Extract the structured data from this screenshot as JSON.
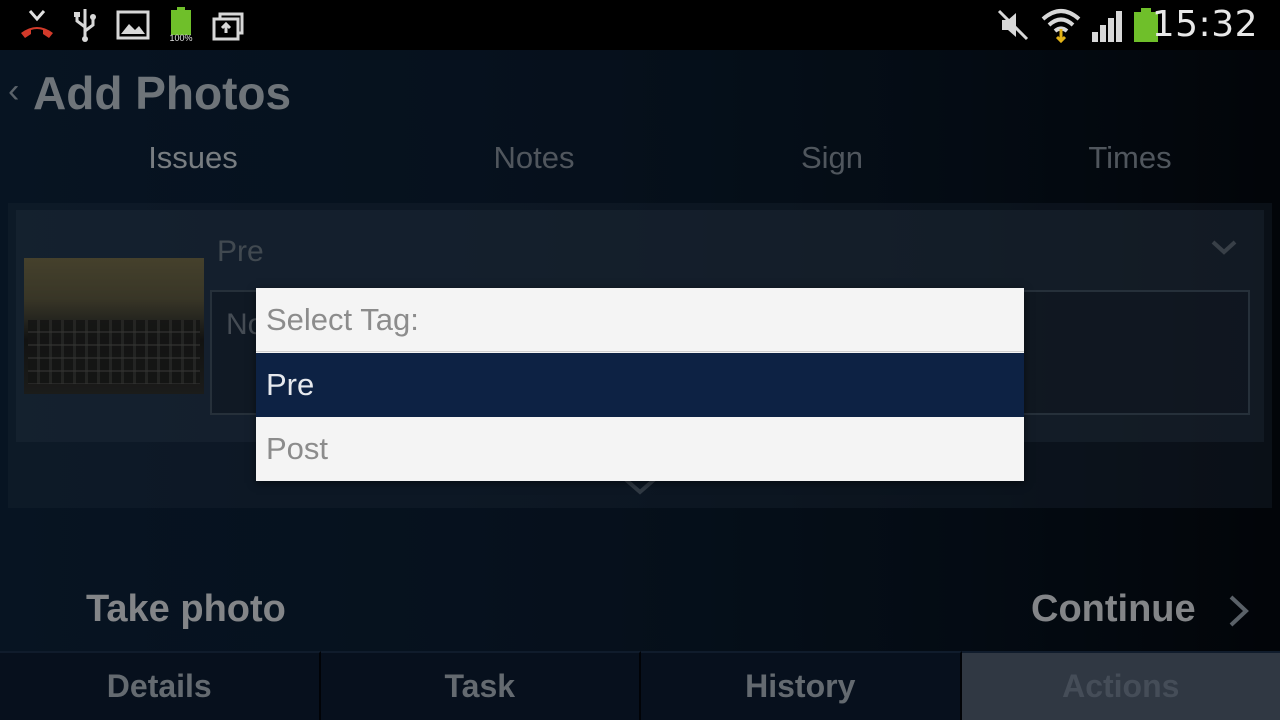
{
  "status_bar": {
    "time": "15:32",
    "battery_label": "100%",
    "icons": [
      "missed-call-icon",
      "usb-icon",
      "image-icon",
      "battery-small-icon",
      "upload-icon",
      "mute-icon",
      "wifi-icon",
      "signal-icon",
      "battery-icon"
    ]
  },
  "header": {
    "back_glyph": "‹",
    "title": "Add Photos"
  },
  "tabs": [
    {
      "label": "Issues"
    },
    {
      "label": "Notes"
    },
    {
      "label": "Sign"
    },
    {
      "label": "Times"
    }
  ],
  "photo_card": {
    "tag_value": "Pre",
    "notes_placeholder": "Notes"
  },
  "actions": {
    "take_photo": "Take photo",
    "continue": "Continue"
  },
  "bottom_nav": [
    {
      "label": "Details"
    },
    {
      "label": "Task"
    },
    {
      "label": "History"
    },
    {
      "label": "Actions"
    }
  ],
  "dialog": {
    "title": "Select Tag:",
    "options": [
      {
        "label": "Pre",
        "selected": true
      },
      {
        "label": "Post",
        "selected": false
      }
    ]
  },
  "colors": {
    "dialog_selected": "#0d2244",
    "dialog_bg": "#f4f4f4",
    "battery_green": "#6fbf2a"
  }
}
